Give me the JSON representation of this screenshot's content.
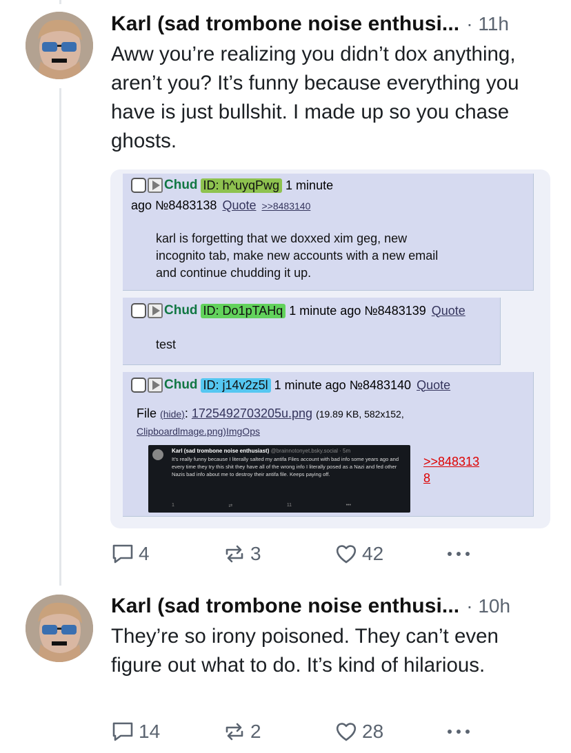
{
  "posts": [
    {
      "author": "Karl (sad trombone noise enthusi...",
      "time": "· 11h",
      "text": "Aww you’re realizing you didn’t dox anything, aren’t you? It’s funny because everything you have is just bullshit. I made up so you chase ghosts.",
      "replies": "4",
      "reposts": "3",
      "likes": "42"
    },
    {
      "author": "Karl (sad trombone noise enthusi...",
      "time": "· 10h",
      "text": "They’re so irony poisoned. They can’t even figure out what to do. It’s kind of hilarious.",
      "replies": "14",
      "reposts": "2",
      "likes": "28"
    }
  ],
  "embed": {
    "chan_posts": [
      {
        "name": "Chud",
        "id_label": "ID: h^uyqPwg",
        "id_color": "#8ec24f",
        "time_a": "1 minute",
        "time_b": "ago",
        "number": "№8483138",
        "quote": "Quote",
        "backlink": ">>8483140",
        "body_lines": [
          "karl is forgetting that we doxxed xim geg, new",
          "incognito tab, make new accounts with a new email",
          "and continue chudding it up."
        ]
      },
      {
        "name": "Chud",
        "id_label": "ID: Do1pTAHq",
        "id_color": "#62d25c",
        "time": "1 minute ago",
        "number": "№8483139",
        "quote": "Quote",
        "body": "test"
      },
      {
        "name": "Chud",
        "id_label": "ID: j14v2z5l",
        "id_color": "#55c7f1",
        "time": "1 minute ago",
        "number": "№8483140",
        "quote": "Quote",
        "file_label": "File",
        "hide": "(hide)",
        "colon": ":",
        "filename": "1725492703205u.png",
        "file_meta": "(19.89 KB, 582x152,",
        "file_meta2": "Clipboardlmage.png)",
        "imgops": "ImgOps",
        "reply_link_a": ">>848313",
        "reply_link_b": "8"
      }
    ],
    "screenshot": {
      "author": "Karl (sad trombone noise enthusiast)",
      "handle": "@brainnotonyet.bsky.social · 5m",
      "text": "It’s really funny because I literally salted my antifa Files account with bad info some years ago and every time they try this shit they have all of the wrong info I literally posed as a Nazi and fed other Nazis bad info about me to destroy their antifa file. Keeps paying off.",
      "reply_count": "1",
      "like_count": "11",
      "more": "•••"
    }
  },
  "colors": {
    "chan_bg": "#d6daf0",
    "embed_bg": "#eef0f8",
    "name_green": "#117743",
    "muted": "#5b6470"
  },
  "icons": [
    "reply-icon",
    "repost-icon",
    "like-icon",
    "more-icon",
    "checkbox-icon",
    "play-icon"
  ]
}
